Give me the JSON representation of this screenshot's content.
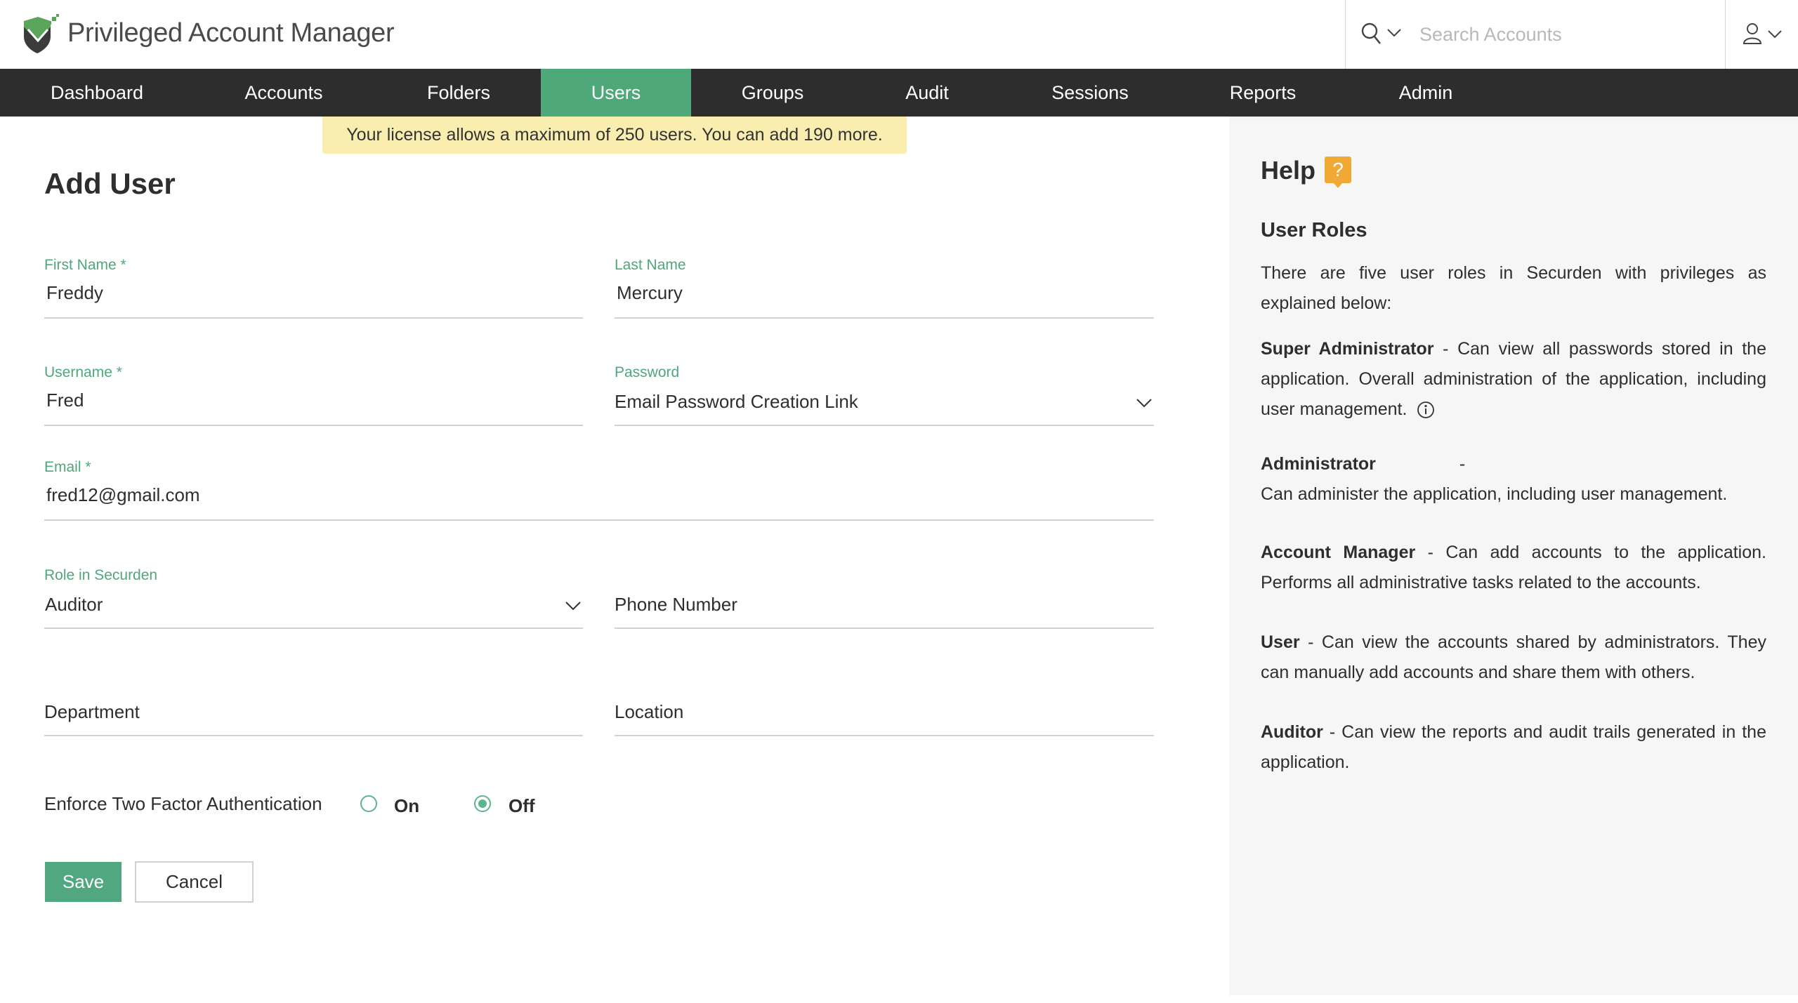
{
  "app": {
    "title": "Privileged Account Manager",
    "logo_icon": "shield-check-logo-icon"
  },
  "search": {
    "icon": "search-icon",
    "placeholder": "Search Accounts",
    "value": ""
  },
  "user_menu": {
    "icon": "user-icon"
  },
  "nav": {
    "items": [
      {
        "label": "Dashboard",
        "active": false
      },
      {
        "label": "Accounts",
        "active": false
      },
      {
        "label": "Folders",
        "active": false
      },
      {
        "label": "Users",
        "active": true
      },
      {
        "label": "Groups",
        "active": false
      },
      {
        "label": "Audit",
        "active": false
      },
      {
        "label": "Sessions",
        "active": false
      },
      {
        "label": "Reports",
        "active": false
      },
      {
        "label": "Admin",
        "active": false
      }
    ]
  },
  "banner": {
    "text": "Your license allows a maximum of 250 users. You can add 190 more."
  },
  "form": {
    "title": "Add User",
    "first_name": {
      "label": "First Name *",
      "value": "Freddy"
    },
    "last_name": {
      "label": "Last Name",
      "value": "Mercury"
    },
    "username": {
      "label": "Username *",
      "value": "Fred"
    },
    "password": {
      "label": "Password",
      "value": "Email Password Creation Link"
    },
    "email": {
      "label": "Email *",
      "value": "fred12@gmail.com"
    },
    "role": {
      "label": "Role in Securden",
      "value": "Auditor"
    },
    "phone": {
      "placeholder": "Phone Number",
      "value": ""
    },
    "department": {
      "placeholder": "Department",
      "value": ""
    },
    "location": {
      "placeholder": "Location",
      "value": ""
    },
    "two_factor": {
      "label": "Enforce Two Factor Authentication",
      "options": [
        {
          "label": "On",
          "selected": false
        },
        {
          "label": "Off",
          "selected": true
        }
      ]
    },
    "save_label": "Save",
    "cancel_label": "Cancel"
  },
  "help": {
    "title": "Help",
    "badge": "?",
    "subtitle": "User Roles",
    "intro": "There are five user roles in Securden with privileges as explained below:",
    "roles": [
      {
        "name": "Super Administrator",
        "desc": "Can view all passwords stored in the application. Overall administration of the application, including user management."
      },
      {
        "name": "Administrator",
        "desc": "Can administer the application, including user management."
      },
      {
        "name": "Account Manager",
        "desc": "Can add accounts to the application. Performs all administrative tasks related to the accounts."
      },
      {
        "name": "User",
        "desc": "Can view the accounts shared by administrators. They can manually add accounts and share them with others."
      },
      {
        "name": "Auditor",
        "desc": "Can view the reports and audit trails generated in the application."
      }
    ],
    "separator": " - "
  },
  "colors": {
    "accent": "#4ea87a",
    "nav_bg": "#2d2d2d",
    "banner_bg": "#f9edb0",
    "help_bg": "#f6f6f6",
    "help_badge": "#f0a935"
  }
}
